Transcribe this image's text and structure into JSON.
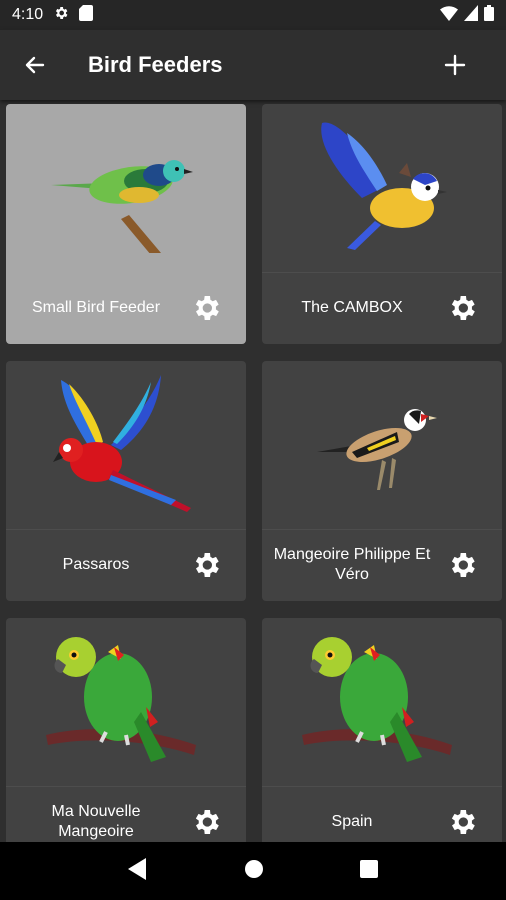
{
  "status": {
    "time": "4:10"
  },
  "app_bar": {
    "title": "Bird Feeders"
  },
  "feeders": [
    {
      "name": "Small Bird Feeder",
      "image": "tanager-bird",
      "selected": true
    },
    {
      "name": "The CAMBOX",
      "image": "blue-tit-bird",
      "selected": false
    },
    {
      "name": "Passaros",
      "image": "macaw-bird",
      "selected": false
    },
    {
      "name": "Mangeoire Philippe Et Véro",
      "image": "goldfinch-bird",
      "selected": false
    },
    {
      "name": "Ma Nouvelle Mangeoire",
      "image": "amazon-parrot-bird",
      "selected": false
    },
    {
      "name": "Spain",
      "image": "amazon-parrot-bird",
      "selected": false
    }
  ],
  "colors": {
    "background": "#2f2f2f",
    "card": "#424242",
    "card_selected": "#a8a8a8",
    "nav": "#000000"
  }
}
